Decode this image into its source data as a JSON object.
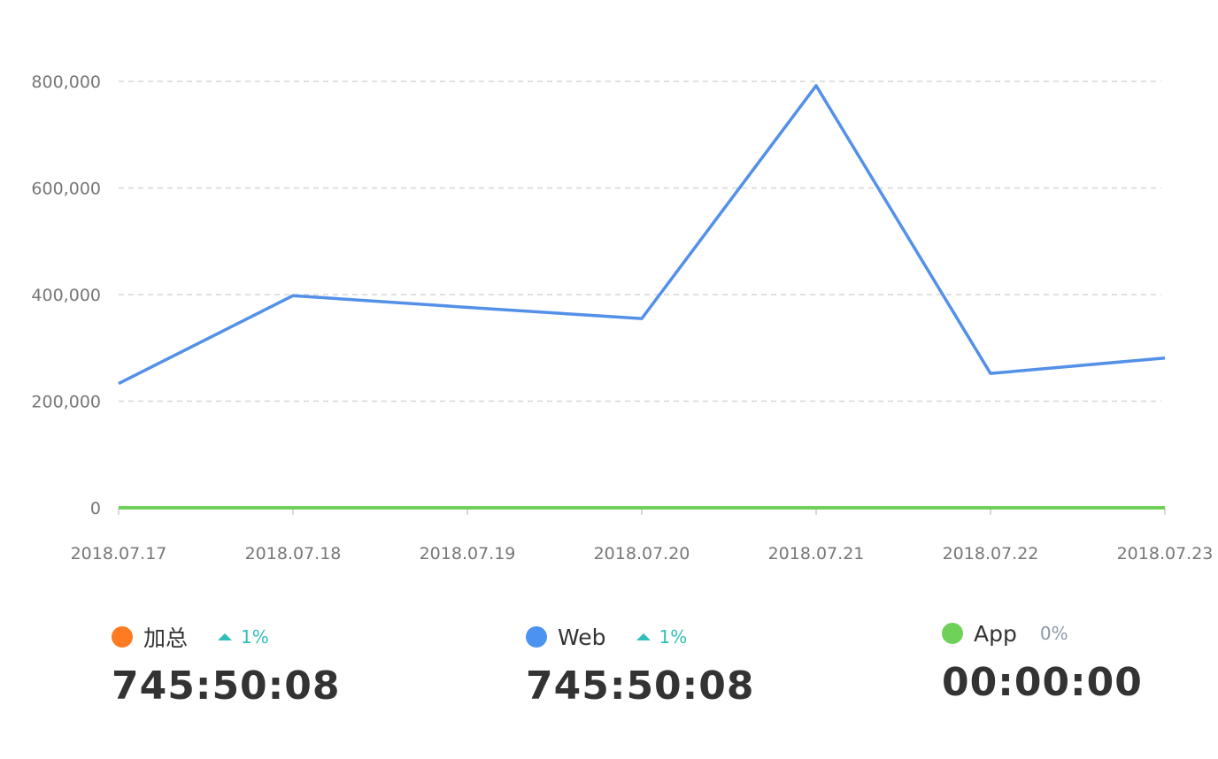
{
  "chart_data": {
    "type": "line",
    "categories": [
      "2018.07.17",
      "2018.07.18",
      "2018.07.19",
      "2018.07.20",
      "2018.07.21",
      "2018.07.22",
      "2018.07.23"
    ],
    "yticks": [
      "0",
      "200,000",
      "400,000",
      "600,000",
      "800,000"
    ],
    "ytick_values": [
      0,
      200000,
      400000,
      600000,
      800000
    ],
    "ylim": [
      0,
      800000
    ],
    "grid": true,
    "series": [
      {
        "name": "Web",
        "color": "#5390e8",
        "values": [
          233000,
          398000,
          376000,
          355000,
          792000,
          252000,
          281000
        ]
      },
      {
        "name": "App",
        "color": "#6fd15a",
        "values": [
          0,
          0,
          0,
          0,
          0,
          0,
          0
        ]
      }
    ]
  },
  "legend": [
    {
      "name": "加总",
      "color": "#ff7b22",
      "change": "1%",
      "change_color": "#2ec0b8",
      "trend": "up",
      "value": "745:50:08"
    },
    {
      "name": "Web",
      "color": "#4c92f0",
      "change": "1%",
      "change_color": "#2ec0b8",
      "trend": "up",
      "value": "745:50:08"
    },
    {
      "name": "App",
      "color": "#6fd15a",
      "change": "0%",
      "change_color": "#8d98a6",
      "trend": "none",
      "value": "00:00:00"
    }
  ]
}
